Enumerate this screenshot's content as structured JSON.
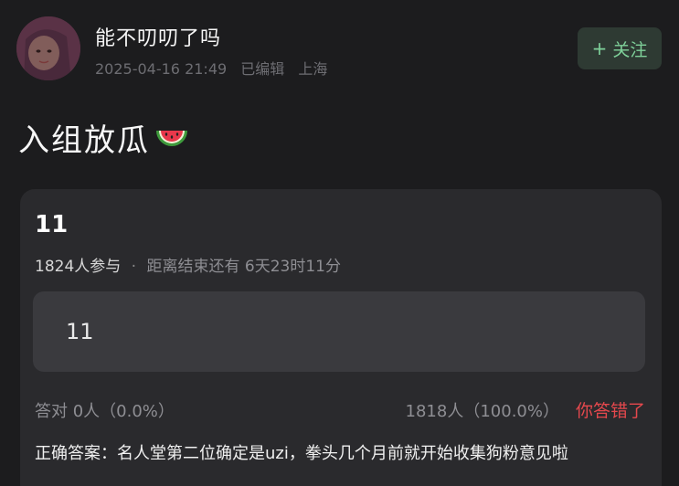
{
  "post": {
    "username": "能不叨叨了吗",
    "date": "2025-04-16 21:49",
    "edited": "已编辑",
    "location": "上海",
    "follow_label": "关注",
    "text": "入组放瓜"
  },
  "poll": {
    "title": "11",
    "participants": "1824人参与",
    "countdown": "距离结束还有 6天23时11分",
    "option_label": "11",
    "correct_label": "答对 0人（0.0%）",
    "wrong_count": "1818人（100.0%）",
    "wrong_status": "你答错了",
    "answer": "正确答案：名人堂第二位确定是uzi，拳头几个月前就开始收集狗粉意见啦"
  },
  "icons": {
    "follow": "plus-icon",
    "post_emoji": "watermelon-icon"
  },
  "colors": {
    "background": "#1c1c1e",
    "card": "#2a2a2d",
    "option": "#3a3a3e",
    "follow_text": "#7fd19a",
    "wrong": "#e5484d"
  }
}
